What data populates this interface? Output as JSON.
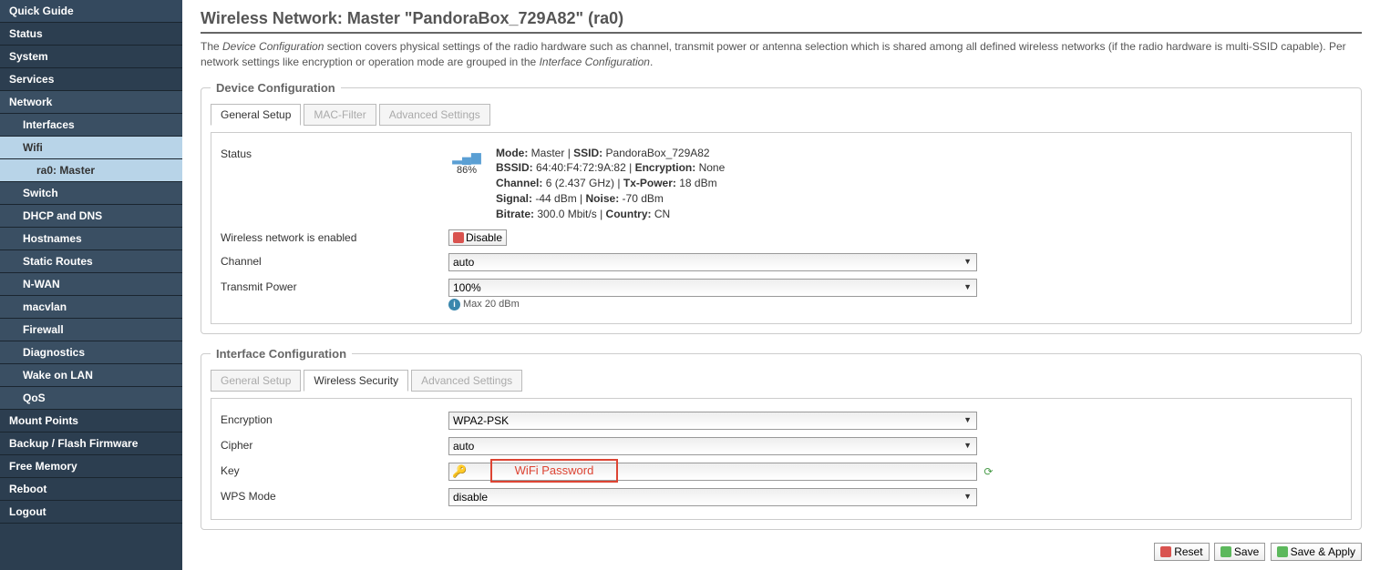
{
  "sidebar": {
    "items": [
      {
        "label": "Quick Guide",
        "level": 0
      },
      {
        "label": "Status",
        "level": 0
      },
      {
        "label": "System",
        "level": 0
      },
      {
        "label": "Services",
        "level": 0
      },
      {
        "label": "Network",
        "level": 0,
        "active": true
      },
      {
        "label": "Interfaces",
        "level": 1
      },
      {
        "label": "Wifi",
        "level": 1,
        "active": true
      },
      {
        "label": "ra0: Master",
        "level": 2
      },
      {
        "label": "Switch",
        "level": 1
      },
      {
        "label": "DHCP and DNS",
        "level": 1
      },
      {
        "label": "Hostnames",
        "level": 1
      },
      {
        "label": "Static Routes",
        "level": 1
      },
      {
        "label": "N-WAN",
        "level": 1
      },
      {
        "label": "macvlan",
        "level": 1
      },
      {
        "label": "Firewall",
        "level": 1
      },
      {
        "label": "Diagnostics",
        "level": 1
      },
      {
        "label": "Wake on LAN",
        "level": 1
      },
      {
        "label": "QoS",
        "level": 1
      },
      {
        "label": "Mount Points",
        "level": 0
      },
      {
        "label": "Backup / Flash Firmware",
        "level": 0
      },
      {
        "label": "Free Memory",
        "level": 0
      },
      {
        "label": "Reboot",
        "level": 0
      },
      {
        "label": "Logout",
        "level": 0
      }
    ]
  },
  "page": {
    "title": "Wireless Network: Master \"PandoraBox_729A82\" (ra0)",
    "desc_prefix": "The ",
    "desc_em1": "Device Configuration",
    "desc_mid": " section covers physical settings of the radio hardware such as channel, transmit power or antenna selection which is shared among all defined wireless networks (if the radio hardware is multi-SSID capable). Per network settings like encryption or operation mode are grouped in the ",
    "desc_em2": "Interface Configuration",
    "desc_suffix": "."
  },
  "device": {
    "legend": "Device Configuration",
    "tabs": [
      "General Setup",
      "MAC-Filter",
      "Advanced Settings"
    ],
    "status_label": "Status",
    "signal_pct": "86%",
    "status": {
      "mode_l": "Mode:",
      "mode_v": "Master",
      "ssid_l": "SSID:",
      "ssid_v": "PandoraBox_729A82",
      "bssid_l": "BSSID:",
      "bssid_v": "64:40:F4:72:9A:82",
      "enc_l": "Encryption:",
      "enc_v": "None",
      "chan_l": "Channel:",
      "chan_v": "6 (2.437 GHz)",
      "txp_l": "Tx-Power:",
      "txp_v": "18 dBm",
      "sig_l": "Signal:",
      "sig_v": "-44 dBm",
      "noise_l": "Noise:",
      "noise_v": "-70 dBm",
      "bit_l": "Bitrate:",
      "bit_v": "300.0 Mbit/s",
      "ctry_l": "Country:",
      "ctry_v": "CN"
    },
    "enabled_label": "Wireless network is enabled",
    "disable_btn": "Disable",
    "channel_label": "Channel",
    "channel_value": "auto",
    "txpower_label": "Transmit Power",
    "txpower_value": "100%",
    "txpower_hint": "Max 20 dBm"
  },
  "iface": {
    "legend": "Interface Configuration",
    "tabs": [
      "General Setup",
      "Wireless Security",
      "Advanced Settings"
    ],
    "enc_label": "Encryption",
    "enc_value": "WPA2-PSK",
    "cipher_label": "Cipher",
    "cipher_value": "auto",
    "key_label": "Key",
    "key_placeholder": "",
    "key_annotation": "WiFi Password",
    "wps_label": "WPS Mode",
    "wps_value": "disable"
  },
  "buttons": {
    "reset": "Reset",
    "save": "Save",
    "save_apply": "Save & Apply"
  }
}
